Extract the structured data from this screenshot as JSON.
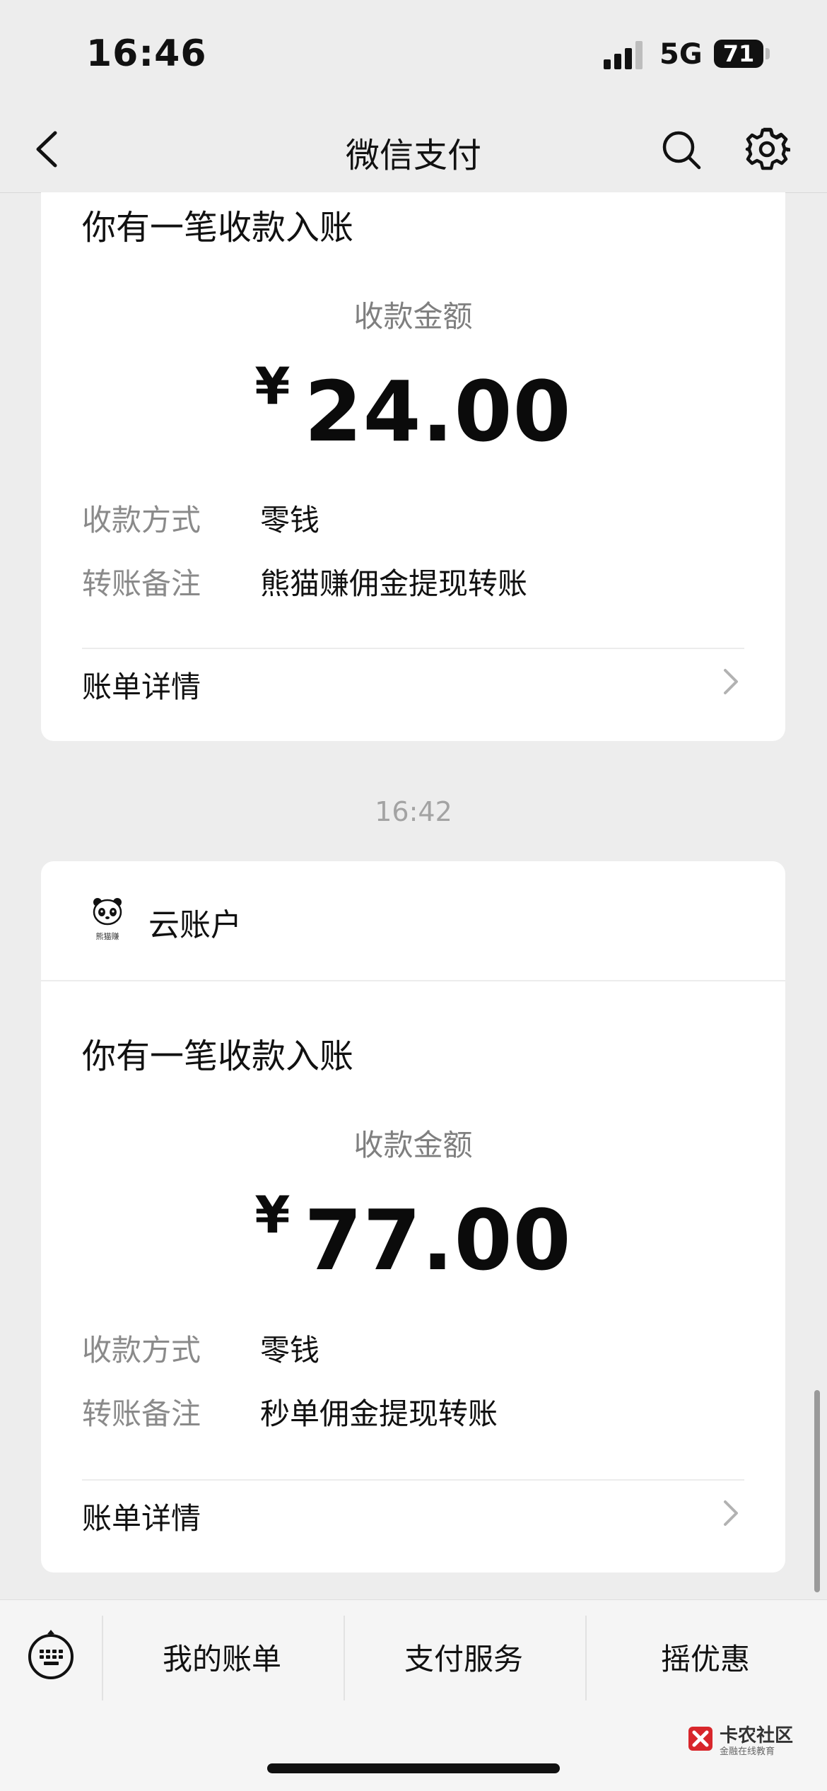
{
  "status_bar": {
    "time": "16:46",
    "network": "5G",
    "battery": "71"
  },
  "nav": {
    "title": "微信支付",
    "back_icon": "chevron-left-icon",
    "search_icon": "search-icon",
    "settings_icon": "gear-icon"
  },
  "messages": [
    {
      "title": "你有一笔收款入账",
      "amount_label": "收款金额",
      "currency": "¥",
      "amount": "24.00",
      "rows": [
        {
          "label": "收款方式",
          "value": "零钱"
        },
        {
          "label": "转账备注",
          "value": "熊猫赚佣金提现转账"
        }
      ],
      "detail_label": "账单详情"
    },
    {
      "timestamp": "16:42",
      "source": "云账户",
      "source_logo_text": "熊猫赚",
      "title": "你有一笔收款入账",
      "amount_label": "收款金额",
      "currency": "¥",
      "amount": "77.00",
      "rows": [
        {
          "label": "收款方式",
          "value": "零钱"
        },
        {
          "label": "转账备注",
          "value": "秒单佣金提现转账"
        }
      ],
      "detail_label": "账单详情"
    }
  ],
  "bottom_bar": {
    "keyboard_icon": "keyboard-icon",
    "items": [
      "我的账单",
      "支付服务",
      "摇优惠"
    ]
  },
  "watermark": {
    "title": "卡农社区",
    "subtitle": "金融在线教育"
  },
  "colors": {
    "background": "#ededed",
    "card": "#ffffff",
    "muted_text": "#8a8a8a"
  }
}
